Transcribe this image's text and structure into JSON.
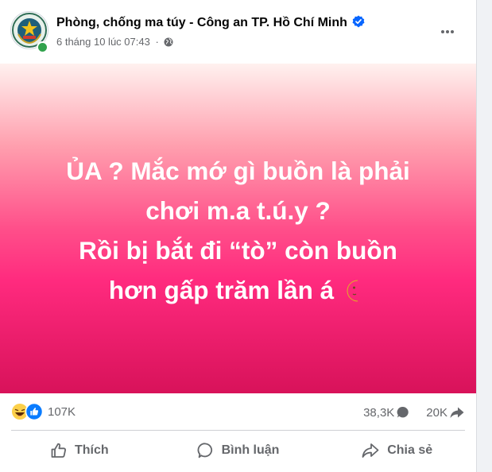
{
  "post": {
    "page_name": "Phòng, chống ma túy - Công an TP. Hồ Chí Minh",
    "timestamp": "6 tháng 10 lúc 07:43",
    "separator": "·",
    "audience_icon": "globe-icon",
    "verified_icon": "verified-badge-icon",
    "more_icon": "more-options-icon"
  },
  "banner": {
    "lines": [
      "ỦA ? Mắc mớ gì buồn là phải",
      "chơi m.a t.ú.y ?",
      "Rồi bị bắt đi “tò” còn buồn",
      "hơn gấp trăm lần á"
    ],
    "emoji": "moon-face-icon",
    "gradient": [
      "#fff1ef",
      "#ff9fae",
      "#ff4f8a",
      "#ff2a7e",
      "#d8125a"
    ]
  },
  "stats": {
    "reactions": "107K",
    "comments": "38,3K",
    "shares": "20K"
  },
  "actions": {
    "like": "Thích",
    "comment": "Bình luận",
    "share": "Chia sẻ"
  },
  "colors": {
    "accent": "#0866ff",
    "text_secondary": "#65676b",
    "online": "#31a24c"
  }
}
